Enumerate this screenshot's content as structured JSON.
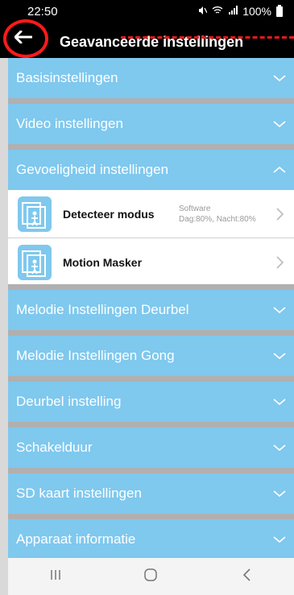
{
  "status": {
    "time": "22:50",
    "signal": "100%"
  },
  "header": {
    "title": "Geavanceerde instellingen"
  },
  "sections": [
    {
      "label": "Basisinstellingen",
      "expanded": false
    },
    {
      "label": "Video instellingen",
      "expanded": false
    },
    {
      "label": "Gevoeligheid instellingen",
      "expanded": true
    },
    {
      "label": "Melodie Instellingen Deurbel",
      "expanded": false
    },
    {
      "label": "Melodie Instellingen Gong",
      "expanded": false
    },
    {
      "label": "Deurbel instelling",
      "expanded": false
    },
    {
      "label": "Schakelduur",
      "expanded": false
    },
    {
      "label": "SD kaart instellingen",
      "expanded": false
    },
    {
      "label": "Apparaat informatie",
      "expanded": false
    }
  ],
  "sensitivity_items": [
    {
      "label": "Detecteer modus",
      "value_line1": "Software",
      "value_line2": "Dag:80%, Nacht:80%"
    },
    {
      "label": "Motion Masker",
      "value_line1": "",
      "value_line2": ""
    }
  ],
  "colors": {
    "accent": "#7fc8ee",
    "annotation": "#ff1a1a"
  },
  "icons": {
    "back": "back-arrow-icon",
    "expand": "chevron-down-icon",
    "collapse": "chevron-up-icon",
    "item": "motion-detect-icon",
    "recent": "recent-apps-icon",
    "home": "home-icon",
    "nav_back": "nav-back-icon"
  }
}
